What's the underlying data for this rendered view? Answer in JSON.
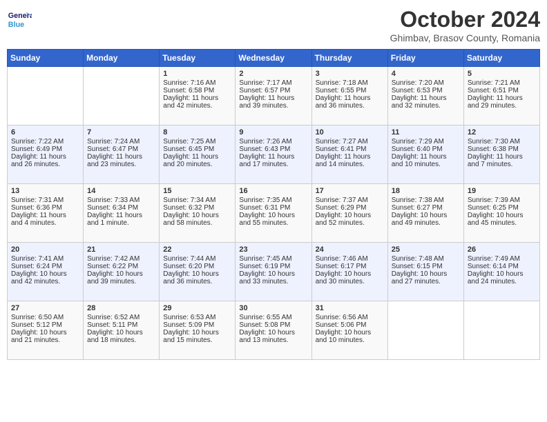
{
  "header": {
    "logo_general": "General",
    "logo_blue": "Blue",
    "month_title": "October 2024",
    "location": "Ghimbav, Brasov County, Romania"
  },
  "days_of_week": [
    "Sunday",
    "Monday",
    "Tuesday",
    "Wednesday",
    "Thursday",
    "Friday",
    "Saturday"
  ],
  "weeks": [
    [
      {
        "day": "",
        "sunrise": "",
        "sunset": "",
        "daylight": ""
      },
      {
        "day": "",
        "sunrise": "",
        "sunset": "",
        "daylight": ""
      },
      {
        "day": "1",
        "sunrise": "Sunrise: 7:16 AM",
        "sunset": "Sunset: 6:58 PM",
        "daylight": "Daylight: 11 hours and 42 minutes."
      },
      {
        "day": "2",
        "sunrise": "Sunrise: 7:17 AM",
        "sunset": "Sunset: 6:57 PM",
        "daylight": "Daylight: 11 hours and 39 minutes."
      },
      {
        "day": "3",
        "sunrise": "Sunrise: 7:18 AM",
        "sunset": "Sunset: 6:55 PM",
        "daylight": "Daylight: 11 hours and 36 minutes."
      },
      {
        "day": "4",
        "sunrise": "Sunrise: 7:20 AM",
        "sunset": "Sunset: 6:53 PM",
        "daylight": "Daylight: 11 hours and 32 minutes."
      },
      {
        "day": "5",
        "sunrise": "Sunrise: 7:21 AM",
        "sunset": "Sunset: 6:51 PM",
        "daylight": "Daylight: 11 hours and 29 minutes."
      }
    ],
    [
      {
        "day": "6",
        "sunrise": "Sunrise: 7:22 AM",
        "sunset": "Sunset: 6:49 PM",
        "daylight": "Daylight: 11 hours and 26 minutes."
      },
      {
        "day": "7",
        "sunrise": "Sunrise: 7:24 AM",
        "sunset": "Sunset: 6:47 PM",
        "daylight": "Daylight: 11 hours and 23 minutes."
      },
      {
        "day": "8",
        "sunrise": "Sunrise: 7:25 AM",
        "sunset": "Sunset: 6:45 PM",
        "daylight": "Daylight: 11 hours and 20 minutes."
      },
      {
        "day": "9",
        "sunrise": "Sunrise: 7:26 AM",
        "sunset": "Sunset: 6:43 PM",
        "daylight": "Daylight: 11 hours and 17 minutes."
      },
      {
        "day": "10",
        "sunrise": "Sunrise: 7:27 AM",
        "sunset": "Sunset: 6:41 PM",
        "daylight": "Daylight: 11 hours and 14 minutes."
      },
      {
        "day": "11",
        "sunrise": "Sunrise: 7:29 AM",
        "sunset": "Sunset: 6:40 PM",
        "daylight": "Daylight: 11 hours and 10 minutes."
      },
      {
        "day": "12",
        "sunrise": "Sunrise: 7:30 AM",
        "sunset": "Sunset: 6:38 PM",
        "daylight": "Daylight: 11 hours and 7 minutes."
      }
    ],
    [
      {
        "day": "13",
        "sunrise": "Sunrise: 7:31 AM",
        "sunset": "Sunset: 6:36 PM",
        "daylight": "Daylight: 11 hours and 4 minutes."
      },
      {
        "day": "14",
        "sunrise": "Sunrise: 7:33 AM",
        "sunset": "Sunset: 6:34 PM",
        "daylight": "Daylight: 11 hours and 1 minute."
      },
      {
        "day": "15",
        "sunrise": "Sunrise: 7:34 AM",
        "sunset": "Sunset: 6:32 PM",
        "daylight": "Daylight: 10 hours and 58 minutes."
      },
      {
        "day": "16",
        "sunrise": "Sunrise: 7:35 AM",
        "sunset": "Sunset: 6:31 PM",
        "daylight": "Daylight: 10 hours and 55 minutes."
      },
      {
        "day": "17",
        "sunrise": "Sunrise: 7:37 AM",
        "sunset": "Sunset: 6:29 PM",
        "daylight": "Daylight: 10 hours and 52 minutes."
      },
      {
        "day": "18",
        "sunrise": "Sunrise: 7:38 AM",
        "sunset": "Sunset: 6:27 PM",
        "daylight": "Daylight: 10 hours and 49 minutes."
      },
      {
        "day": "19",
        "sunrise": "Sunrise: 7:39 AM",
        "sunset": "Sunset: 6:25 PM",
        "daylight": "Daylight: 10 hours and 45 minutes."
      }
    ],
    [
      {
        "day": "20",
        "sunrise": "Sunrise: 7:41 AM",
        "sunset": "Sunset: 6:24 PM",
        "daylight": "Daylight: 10 hours and 42 minutes."
      },
      {
        "day": "21",
        "sunrise": "Sunrise: 7:42 AM",
        "sunset": "Sunset: 6:22 PM",
        "daylight": "Daylight: 10 hours and 39 minutes."
      },
      {
        "day": "22",
        "sunrise": "Sunrise: 7:44 AM",
        "sunset": "Sunset: 6:20 PM",
        "daylight": "Daylight: 10 hours and 36 minutes."
      },
      {
        "day": "23",
        "sunrise": "Sunrise: 7:45 AM",
        "sunset": "Sunset: 6:19 PM",
        "daylight": "Daylight: 10 hours and 33 minutes."
      },
      {
        "day": "24",
        "sunrise": "Sunrise: 7:46 AM",
        "sunset": "Sunset: 6:17 PM",
        "daylight": "Daylight: 10 hours and 30 minutes."
      },
      {
        "day": "25",
        "sunrise": "Sunrise: 7:48 AM",
        "sunset": "Sunset: 6:15 PM",
        "daylight": "Daylight: 10 hours and 27 minutes."
      },
      {
        "day": "26",
        "sunrise": "Sunrise: 7:49 AM",
        "sunset": "Sunset: 6:14 PM",
        "daylight": "Daylight: 10 hours and 24 minutes."
      }
    ],
    [
      {
        "day": "27",
        "sunrise": "Sunrise: 6:50 AM",
        "sunset": "Sunset: 5:12 PM",
        "daylight": "Daylight: 10 hours and 21 minutes."
      },
      {
        "day": "28",
        "sunrise": "Sunrise: 6:52 AM",
        "sunset": "Sunset: 5:11 PM",
        "daylight": "Daylight: 10 hours and 18 minutes."
      },
      {
        "day": "29",
        "sunrise": "Sunrise: 6:53 AM",
        "sunset": "Sunset: 5:09 PM",
        "daylight": "Daylight: 10 hours and 15 minutes."
      },
      {
        "day": "30",
        "sunrise": "Sunrise: 6:55 AM",
        "sunset": "Sunset: 5:08 PM",
        "daylight": "Daylight: 10 hours and 13 minutes."
      },
      {
        "day": "31",
        "sunrise": "Sunrise: 6:56 AM",
        "sunset": "Sunset: 5:06 PM",
        "daylight": "Daylight: 10 hours and 10 minutes."
      },
      {
        "day": "",
        "sunrise": "",
        "sunset": "",
        "daylight": ""
      },
      {
        "day": "",
        "sunrise": "",
        "sunset": "",
        "daylight": ""
      }
    ]
  ]
}
